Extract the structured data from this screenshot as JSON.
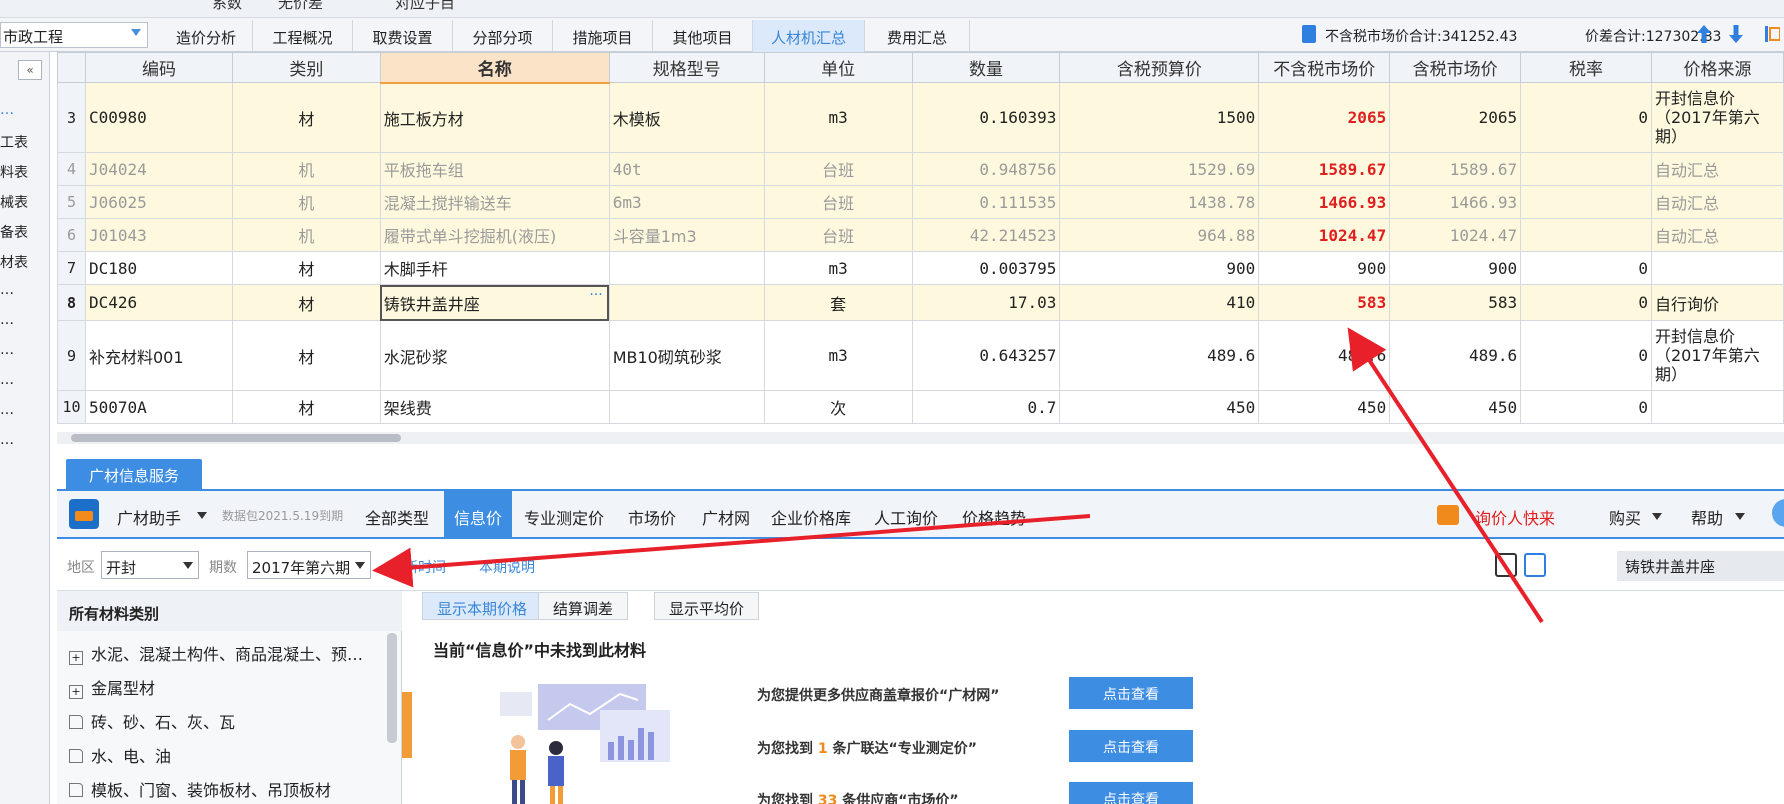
{
  "topstrip": {
    "items": [
      "系数",
      "无价差",
      "对应子目"
    ]
  },
  "project": {
    "name": "市政工程"
  },
  "tabs": [
    "造价分析",
    "工程概况",
    "取费设置",
    "分部分项",
    "措施项目",
    "其他项目",
    "人材机汇总",
    "费用汇总"
  ],
  "active_tab": "人材机汇总",
  "summary": {
    "tax_excl_total": "不含税市场价合计:341252.43",
    "diff_total": "价差合计:127302.83"
  },
  "sidebar": {
    "items": [
      "…",
      "工表",
      "料表",
      "械表",
      "备表",
      "材表",
      "…",
      "…",
      "…",
      "…",
      "…",
      "…"
    ]
  },
  "grid": {
    "headers": [
      "编码",
      "类别",
      "名称",
      "规格型号",
      "单位",
      "数量",
      "含税预算价",
      "不含税市场价",
      "含税市场价",
      "税率",
      "价格来源"
    ],
    "rows": [
      {
        "n": "3",
        "code": "C00980",
        "cat": "材",
        "name": "施工板方材",
        "spec": "木模板",
        "unit": "m3",
        "qty": "0.160393",
        "budget": "1500",
        "mkt": "2065",
        "mkt_tax": "2065",
        "rate": "0",
        "src": "开封信息价（2017年第六期）"
      },
      {
        "n": "4",
        "code": "J04024",
        "cat": "机",
        "name": "平板拖车组",
        "spec": "40t",
        "unit": "台班",
        "qty": "0.948756",
        "budget": "1529.69",
        "mkt": "1589.67",
        "mkt_tax": "1589.67",
        "rate": "",
        "src": "自动汇总"
      },
      {
        "n": "5",
        "code": "J06025",
        "cat": "机",
        "name": "混凝土搅拌输送车",
        "spec": "6m3",
        "unit": "台班",
        "qty": "0.111535",
        "budget": "1438.78",
        "mkt": "1466.93",
        "mkt_tax": "1466.93",
        "rate": "",
        "src": "自动汇总"
      },
      {
        "n": "6",
        "code": "J01043",
        "cat": "机",
        "name": "履带式单斗挖掘机(液压)",
        "spec": "斗容量1m3",
        "unit": "台班",
        "qty": "42.214523",
        "budget": "964.88",
        "mkt": "1024.47",
        "mkt_tax": "1024.47",
        "rate": "",
        "src": "自动汇总"
      },
      {
        "n": "7",
        "code": "DC180",
        "cat": "材",
        "name": "木脚手杆",
        "spec": "",
        "unit": "m3",
        "qty": "0.003795",
        "budget": "900",
        "mkt": "900",
        "mkt_tax": "900",
        "rate": "0",
        "src": ""
      },
      {
        "n": "8",
        "code": "DC426",
        "cat": "材",
        "name": "铸铁井盖井座",
        "spec": "",
        "unit": "套",
        "qty": "17.03",
        "budget": "410",
        "mkt": "583",
        "mkt_tax": "583",
        "rate": "0",
        "src": "自行询价"
      },
      {
        "n": "9",
        "code": "补充材料001",
        "cat": "材",
        "name": "水泥砂浆",
        "spec": "MB10砌筑砂浆",
        "unit": "m3",
        "qty": "0.643257",
        "budget": "489.6",
        "mkt": "489.6",
        "mkt_tax": "489.6",
        "rate": "0",
        "src": "开封信息价（2017年第六期）"
      },
      {
        "n": "10",
        "code": "50070A",
        "cat": "材",
        "name": "架线费",
        "spec": "",
        "unit": "次",
        "qty": "0.7",
        "budget": "450",
        "mkt": "450",
        "mkt_tax": "450",
        "rate": "0",
        "src": ""
      }
    ]
  },
  "panel": {
    "tab": "广材信息服务",
    "title": "广材助手",
    "subtitle": "数据包2021.5.19到期",
    "nav": [
      "全部类型",
      "信息价",
      "专业测定价",
      "市场价",
      "广材网",
      "企业价格库",
      "人工询价",
      "价格趋势"
    ],
    "nav_active": "信息价",
    "rights": [
      "询价人快来",
      "购买",
      "帮助"
    ]
  },
  "filter": {
    "region_label": "地区",
    "region": "开封",
    "period_label": "期数",
    "period": "2017年第六期",
    "update_link": "更新时间",
    "desc_link": "本期说明",
    "search_value": "铸铁井盖井座"
  },
  "categories": {
    "header": "所有材料类别",
    "items": [
      "水泥、混凝土构件、商品混凝土、预…",
      "金属型材",
      "砖、砂、石、灰、瓦",
      "水、电、油",
      "模板、门窗、装饰板材、吊顶板材"
    ]
  },
  "subtabs": [
    "显示本期价格",
    "结算调差",
    "显示平均价"
  ],
  "result": {
    "not_found": "当前“信息价”中未找到此材料",
    "suggestions": [
      {
        "pre": "为您提供更多供应商盖章报价“广材网”",
        "num": "",
        "post": ""
      },
      {
        "pre": "为您找到 ",
        "num": "1",
        "post": " 条广联达“专业测定价”"
      },
      {
        "pre": "为您找到 ",
        "num": "33",
        "post": " 条供应商“市场价”"
      }
    ],
    "button": "点击查看"
  },
  "colors": {
    "accent": "#3d8ee3",
    "price_red": "#e02020",
    "annotation": "#e8202a",
    "row_yellow": "#fef9de"
  }
}
